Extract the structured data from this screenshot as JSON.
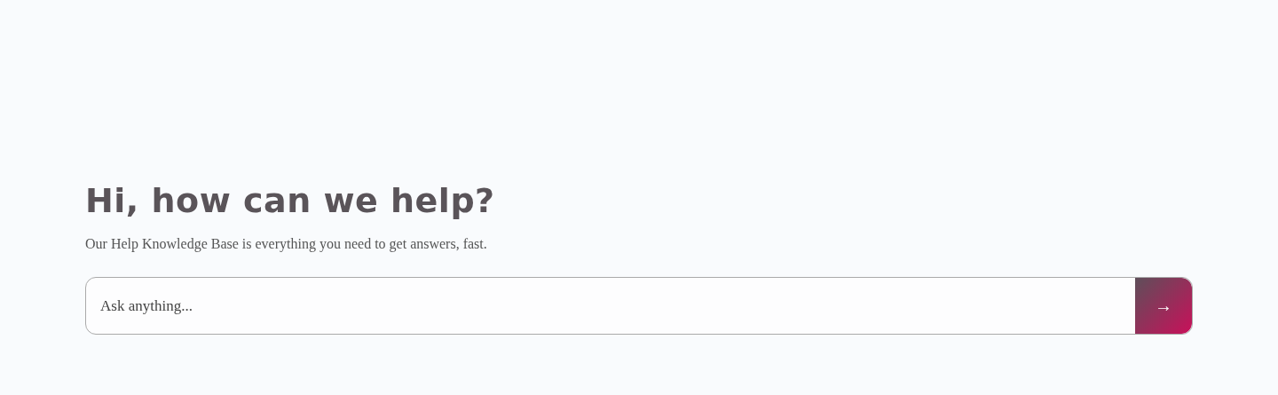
{
  "heading": "Hi, how can we help?",
  "subtitle": "Our Help Knowledge Base is everything you need to get answers, fast.",
  "search": {
    "placeholder": "Ask anything...",
    "button": "→"
  }
}
